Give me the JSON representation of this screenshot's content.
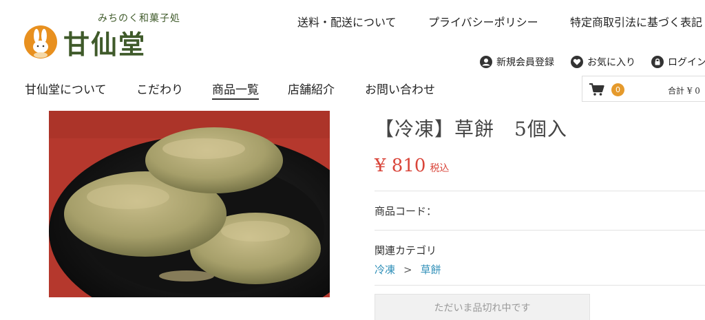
{
  "logo": {
    "tagline": "みちのく和菓子処",
    "name": "甘仙堂"
  },
  "top_links": [
    "送料・配送について",
    "プライバシーポリシー",
    "特定商取引法に基づく表記"
  ],
  "member_links": [
    {
      "label": "新規会員登録",
      "icon": "user-icon"
    },
    {
      "label": "お気に入り",
      "icon": "heart-icon"
    },
    {
      "label": "ログイン",
      "icon": "lock-icon"
    }
  ],
  "main_nav": [
    "甘仙堂について",
    "こだわり",
    "商品一覧",
    "店舗紹介",
    "お問い合わせ"
  ],
  "cart": {
    "count": "0",
    "total": "合計 ¥ 0",
    "icon": "cart-icon",
    "badge_color": "#e59a2c"
  },
  "product": {
    "title": "【冷凍】草餅　5個入",
    "price": "¥ 810",
    "tax_label": "税込",
    "code_label": "商品コード：",
    "category_label": "関連カテゴリ",
    "categories": [
      "冷凍",
      "草餅"
    ],
    "crumb_separator": ">",
    "soldout_label": "ただいま品切れ中です",
    "price_color": "#d9453a",
    "link_color": "#2f8fb8"
  }
}
